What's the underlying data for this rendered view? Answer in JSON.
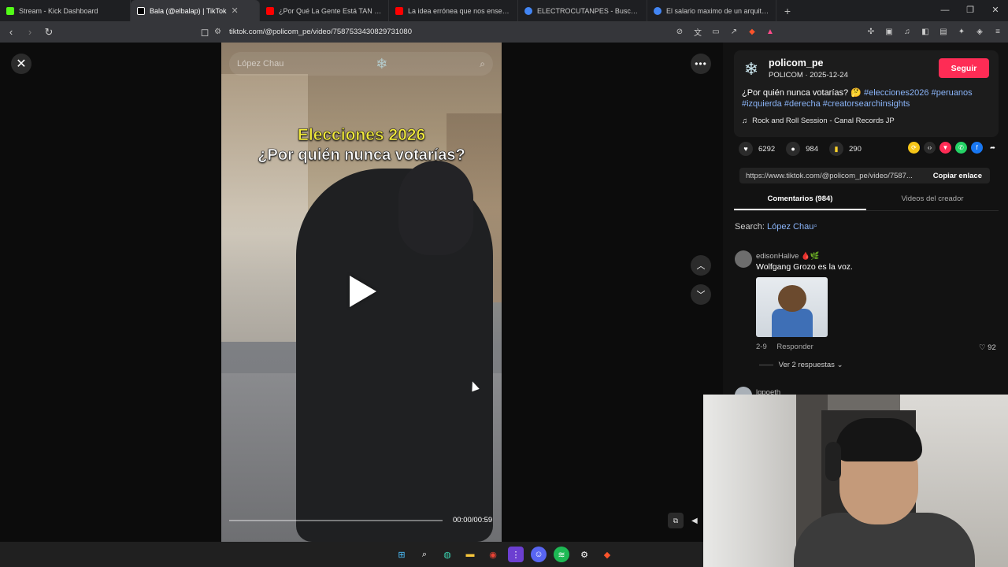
{
  "browser": {
    "tabs": [
      {
        "label": "Stream - Kick Dashboard",
        "color": "#53fc18"
      },
      {
        "label": "Bala (@elbalap) | TikTok",
        "color": "#ffffff",
        "active": true
      },
      {
        "label": "¿Por Qué La Gente Está TAN Confiad",
        "color": "#ff0000"
      },
      {
        "label": "La idea errónea que nos enseñan sob",
        "color": "#ff0000"
      },
      {
        "label": "ELECTROCUTANPES - Buscar con Goo",
        "color": "#4285f4"
      },
      {
        "label": "El salario maximo de un arquitecto -",
        "color": "#4285f4"
      }
    ],
    "url": "tiktok.com/@policom_pe/video/7587533430829731080"
  },
  "video": {
    "search_text": "López Chau",
    "caption_line1": "Elecciones 2026",
    "caption_line2": "¿Por quién nunca votarías?",
    "time": "00:00/00:59"
  },
  "post": {
    "username": "policom_pe",
    "subline": "POLICOM · 2025-12-24",
    "follow_label": "Seguir",
    "desc_text": "¿Por quién nunca votarías? 🤔 ",
    "hashtags": [
      "#elecciones2026",
      "#peruanos",
      "#izquierda",
      "#derecha",
      "#creatorsearchinsights"
    ],
    "music": "Rock and Roll Session - Canal Records JP",
    "likes": "6292",
    "comments": "984",
    "saves": "290",
    "link": "https://www.tiktok.com/@policom_pe/video/7587...",
    "copy_label": "Copiar enlace",
    "tab_comments": "Comentarios (984)",
    "tab_creator": "Videos del creador",
    "search_prefix": "Search:",
    "search_keyword": "López Chau"
  },
  "comments": [
    {
      "user": "edisonHalive 🩸🌿",
      "text": "Wolfgang Grozo es la voz.",
      "date": "2-9",
      "reply": "Responder",
      "likes": "92",
      "replies": "Ver 2 respuestas"
    },
    {
      "user": "lgpoeth"
    }
  ],
  "colors": {
    "follow": "#fe2c55",
    "hashtag": "#8ab4f8"
  }
}
